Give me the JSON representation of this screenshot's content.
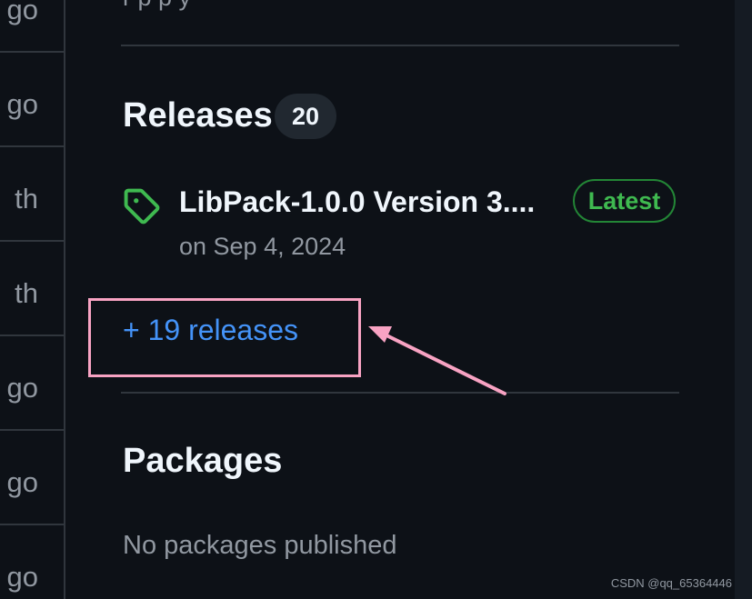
{
  "file_list": {
    "row_suffixes": [
      "go",
      "go",
      "th",
      "th",
      "go",
      "go",
      "go"
    ]
  },
  "sidebar": {
    "top_partial_text": "r   p          p       y",
    "releases": {
      "title": "Releases",
      "count": "20",
      "latest": {
        "name": "LibPack-1.0.0 Version 3....",
        "badge": "Latest",
        "date": "on Sep 4, 2024",
        "icon": "tag-icon"
      },
      "more_link": "+ 19 releases"
    },
    "packages": {
      "title": "Packages",
      "empty_text": "No packages published"
    }
  },
  "annotation": {
    "color": "#f8a3c3"
  },
  "watermark": "CSDN @qq_65364446",
  "colors": {
    "background": "#0d1117",
    "link": "#4493f8",
    "success": "#3fb950",
    "muted": "#9198a1",
    "border": "#30363d"
  }
}
